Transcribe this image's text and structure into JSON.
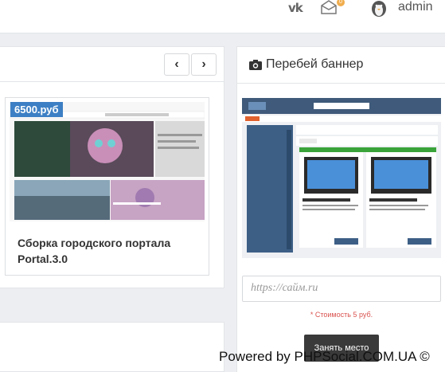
{
  "topbar": {
    "vk_label": "vk",
    "mail_badge": "0",
    "username": "admin"
  },
  "product": {
    "price": "6500.руб",
    "title": "Сборка городского портала Portal.3.0"
  },
  "banner_panel": {
    "title": "Перебей баннер",
    "url_placeholder": "https://сайм.ru",
    "cost_text": "* Стоимость 5 руб.",
    "button_label": "Занять место"
  },
  "footer": {
    "powered_text": "Powered by PHPSocial.COM.UA ©"
  },
  "colors": {
    "accent": "#3d7fc4",
    "button": "#3a3a3a",
    "warning": "#d9534f"
  }
}
